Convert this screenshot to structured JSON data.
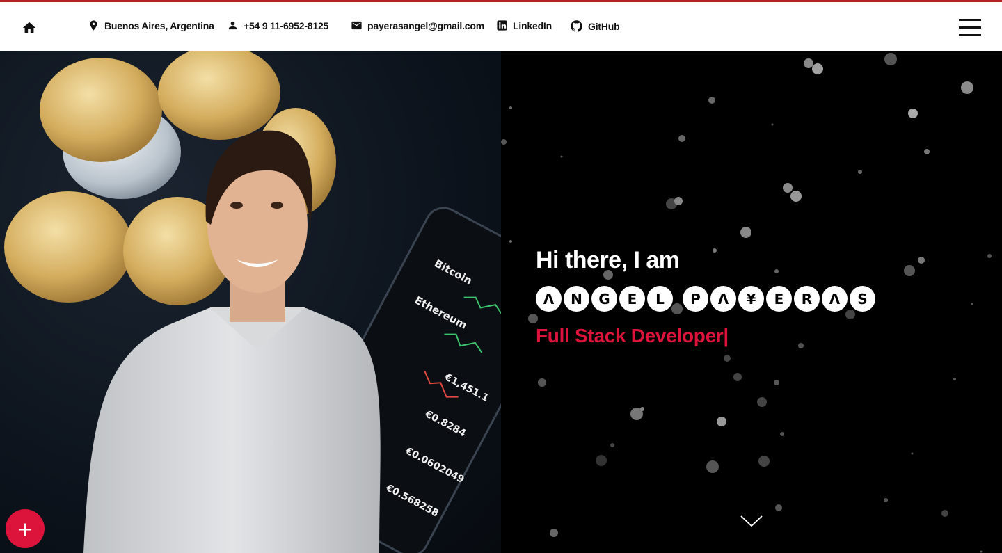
{
  "nav": {
    "home_icon": "home-icon",
    "location": "Buenos Aires, Argentina",
    "phone": "+54 9 11-6952-8125",
    "email": "payerasangel@gmail.com",
    "linkedin": "LinkedIn",
    "github": "GitHub",
    "menu_icon": "hamburger-menu-icon",
    "accent": "#b51c1c"
  },
  "hero": {
    "greeting": "Hi there, I am",
    "name_letters": [
      "Λ",
      "N",
      "G",
      "E",
      "L",
      "P",
      "Λ",
      "¥",
      "E",
      "R",
      "Λ",
      "S"
    ],
    "role": "Full Stack Developer|",
    "role_color": "#dc143c"
  },
  "fab": {
    "label": "+",
    "color": "#dc143c"
  },
  "scroll": {
    "icon": "chevron-down-icon"
  }
}
